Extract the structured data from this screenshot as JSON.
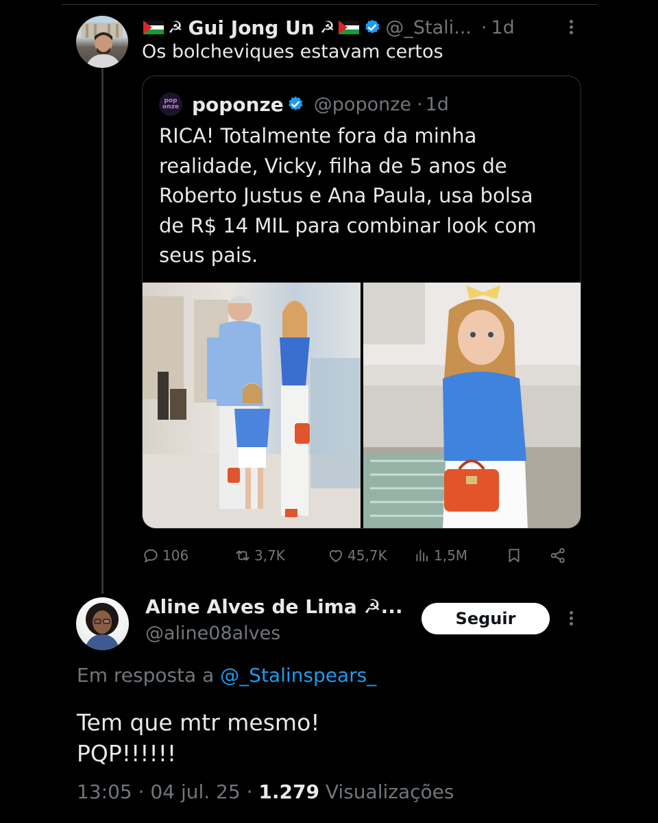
{
  "tweet1": {
    "display_name": "Gui Jong Un",
    "name_symbol": "☭",
    "handle": "@_Stali...",
    "time": "1d",
    "text": "Os bolcheviques estavam certos"
  },
  "quote": {
    "logo_text_top": "pop",
    "logo_text_bottom": "onze",
    "display_name": "poponze",
    "handle": "@poponze",
    "time": "1d",
    "text": "RICA! Totalmente fora da minha realidade, Vicky, filha de 5 anos de Roberto Justus e Ana Paula, usa bolsa de R$ 14 MIL para combinar look com seus pais."
  },
  "actions": {
    "replies": "106",
    "reposts": "3,7K",
    "likes": "45,7K",
    "views": "1,5M"
  },
  "tweet2": {
    "display_name": "Aline Alves de Lima ☭...",
    "handle": "@aline08alves",
    "follow_label": "Seguir",
    "reply_prefix": "Em resposta a",
    "reply_mention": "@_Stalinspears_",
    "text": "Tem que mtr mesmo!\nPQP!!!!!!",
    "time": "13:05",
    "date": "04 jul. 25",
    "views_count": "1.279",
    "views_label": "Visualizações"
  },
  "colors": {
    "background": "#000000",
    "text_primary": "#e7e9ea",
    "text_secondary": "#71767b",
    "link": "#1d9bf0",
    "verified": "#1d9bf0",
    "border": "#2f3336"
  },
  "icons": [
    "verified-badge-icon",
    "more-options-icon",
    "reply-icon",
    "repost-icon",
    "like-icon",
    "views-icon",
    "bookmark-icon",
    "share-icon",
    "palestine-flag-icon"
  ]
}
